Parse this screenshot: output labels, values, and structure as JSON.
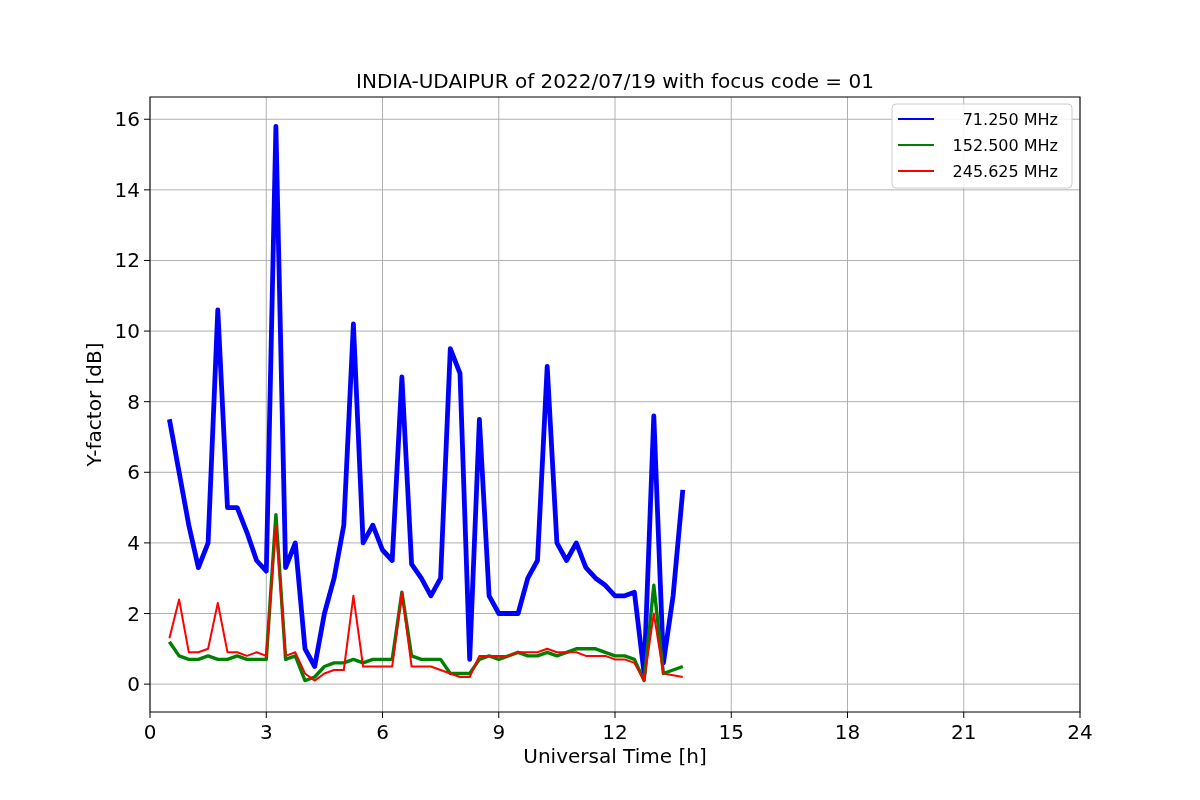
{
  "plot": {
    "chart_data": {
      "type": "line",
      "title": "INDIA-UDAIPUR of 2022/07/19 with focus code = 01",
      "xlabel": "Universal Time [h]",
      "ylabel": "Y-factor [dB]",
      "x": [
        0.5,
        0.75,
        1.0,
        1.25,
        1.5,
        1.75,
        2.0,
        2.25,
        2.5,
        2.75,
        3.0,
        3.25,
        3.5,
        3.75,
        4.0,
        4.25,
        4.5,
        4.75,
        5.0,
        5.25,
        5.5,
        5.75,
        6.0,
        6.25,
        6.5,
        6.75,
        7.0,
        7.25,
        7.5,
        7.75,
        8.0,
        8.25,
        8.5,
        8.75,
        9.0,
        9.25,
        9.5,
        9.75,
        10.0,
        10.25,
        10.5,
        10.75,
        11.0,
        11.25,
        11.5,
        11.75,
        12.0,
        12.25,
        12.5,
        12.75,
        13.0,
        13.25,
        13.5,
        13.75
      ],
      "series": [
        {
          "name": "71.250 MHz",
          "color": "#0000ff",
          "values": [
            7.5,
            6.0,
            4.5,
            3.3,
            4.0,
            10.6,
            5.0,
            5.0,
            4.3,
            3.5,
            3.2,
            15.8,
            3.3,
            4.0,
            1.0,
            0.5,
            2.0,
            3.0,
            4.5,
            10.2,
            4.0,
            4.5,
            3.8,
            3.5,
            8.7,
            3.4,
            3.0,
            2.5,
            3.0,
            9.5,
            8.8,
            0.7,
            7.5,
            2.5,
            2.0,
            2.0,
            2.0,
            3.0,
            3.5,
            9.0,
            4.0,
            3.5,
            4.0,
            3.3,
            3.0,
            2.8,
            2.5,
            2.5,
            2.6,
            0.3,
            7.6,
            0.6,
            2.5,
            5.5
          ]
        },
        {
          "name": "152.500 MHz",
          "color": "#008000",
          "values": [
            1.2,
            0.8,
            0.7,
            0.7,
            0.8,
            0.7,
            0.7,
            0.8,
            0.7,
            0.7,
            0.7,
            4.8,
            0.7,
            0.8,
            0.1,
            0.2,
            0.5,
            0.6,
            0.6,
            0.7,
            0.6,
            0.7,
            0.7,
            0.7,
            2.6,
            0.8,
            0.7,
            0.7,
            0.7,
            0.3,
            0.3,
            0.3,
            0.7,
            0.8,
            0.7,
            0.8,
            0.9,
            0.8,
            0.8,
            0.9,
            0.8,
            0.9,
            1.0,
            1.0,
            1.0,
            0.9,
            0.8,
            0.8,
            0.7,
            0.1,
            2.8,
            0.3,
            0.4,
            0.5
          ]
        },
        {
          "name": "245.625 MHz",
          "color": "#ff0000",
          "values": [
            1.3,
            2.4,
            0.9,
            0.9,
            1.0,
            2.3,
            0.9,
            0.9,
            0.8,
            0.9,
            0.8,
            4.5,
            0.8,
            0.9,
            0.3,
            0.1,
            0.3,
            0.4,
            0.4,
            2.5,
            0.5,
            0.5,
            0.5,
            0.5,
            2.6,
            0.5,
            0.5,
            0.5,
            0.4,
            0.3,
            0.2,
            0.2,
            0.8,
            0.8,
            0.8,
            0.8,
            0.9,
            0.9,
            0.9,
            1.0,
            0.9,
            0.9,
            0.9,
            0.8,
            0.8,
            0.8,
            0.7,
            0.7,
            0.6,
            0.1,
            2.0,
            0.3,
            0.25,
            0.2
          ]
        }
      ],
      "grid": true,
      "legend": true,
      "xlim": [
        0,
        24
      ],
      "ylim": [
        -0.79,
        16.63
      ],
      "xticks": [
        0,
        3,
        6,
        9,
        12,
        15,
        18,
        21,
        24
      ],
      "yticks": [
        0,
        2,
        4,
        6,
        8,
        10,
        12,
        14,
        16
      ]
    }
  }
}
